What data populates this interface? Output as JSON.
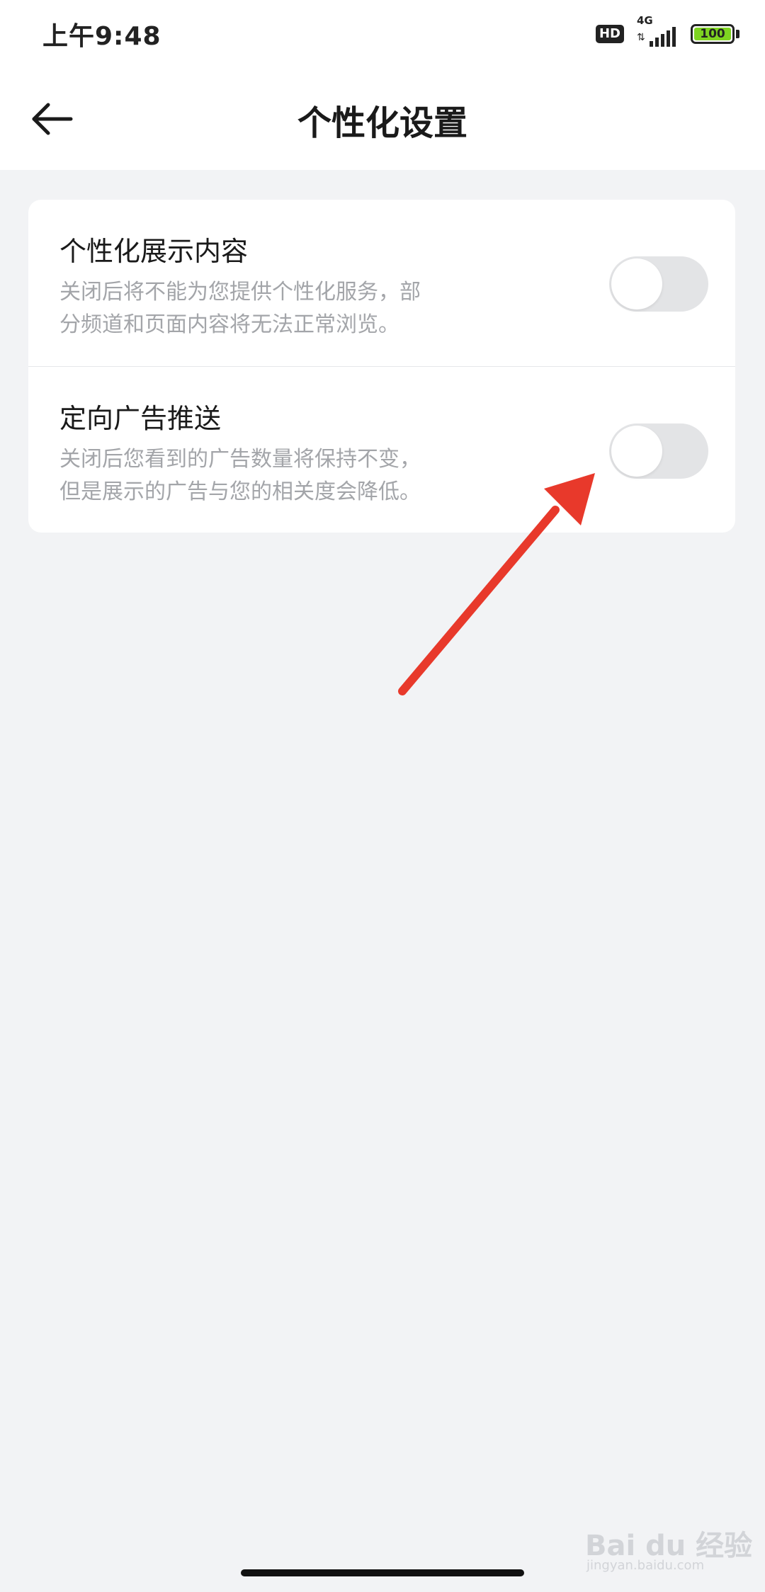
{
  "status_bar": {
    "time": "上午9:48",
    "hd_label": "HD",
    "network_label": "4G",
    "battery_level": "100",
    "icons": [
      "hd-icon",
      "signal-icon",
      "battery-icon"
    ]
  },
  "nav": {
    "back_icon": "arrow-left-icon",
    "title": "个性化设置"
  },
  "settings": [
    {
      "title": "个性化展示内容",
      "desc_line1": "关闭后将不能为您提供个性化服务，部",
      "desc_line2": "分频道和页面内容将无法正常浏览。",
      "enabled": false
    },
    {
      "title": "定向广告推送",
      "desc_line1": "关闭后您看到的广告数量将保持不变，",
      "desc_line2": "但是展示的广告与您的相关度会降低。",
      "enabled": false
    }
  ],
  "colors": {
    "background": "#f2f3f5",
    "card": "#ffffff",
    "toggle_off": "#e3e4e6",
    "annotation_arrow": "#e8392b",
    "battery": "#7ed321"
  },
  "watermark": {
    "text": "Bai du 经验",
    "sub": "jingyan.baidu.com"
  }
}
